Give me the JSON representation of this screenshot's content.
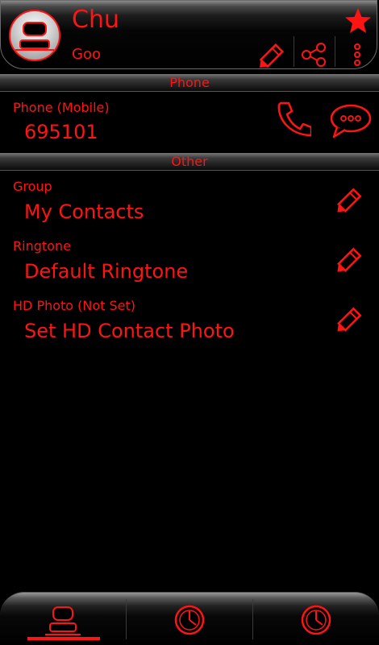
{
  "contact": {
    "name": "Chu",
    "subtitle": "Goo",
    "starred": true,
    "avatar_icon": "person-icon"
  },
  "header_actions": [
    {
      "name": "edit-icon"
    },
    {
      "name": "share-icon"
    },
    {
      "name": "more-vert-icon"
    }
  ],
  "sections": {
    "phone_title": "Phone",
    "other_title": "Other"
  },
  "phone": {
    "label": "Phone  (Mobile)",
    "number": "695101",
    "call_icon": "phone-call-icon",
    "message_icon": "message-bubble-icon"
  },
  "other": {
    "group_label": "Group",
    "group_value": "My Contacts",
    "ringtone_label": "Ringtone",
    "ringtone_value": "Default Ringtone",
    "hdphoto_label": "HD Photo (Not Set)",
    "hdphoto_value": "Set HD Contact Photo"
  },
  "bottom_nav": {
    "tabs": [
      "contact-tab",
      "recent-calls-tab",
      "call-history-tab"
    ],
    "active_tab": 0
  },
  "colors": {
    "accent": "#ff1414",
    "background": "#000000"
  }
}
